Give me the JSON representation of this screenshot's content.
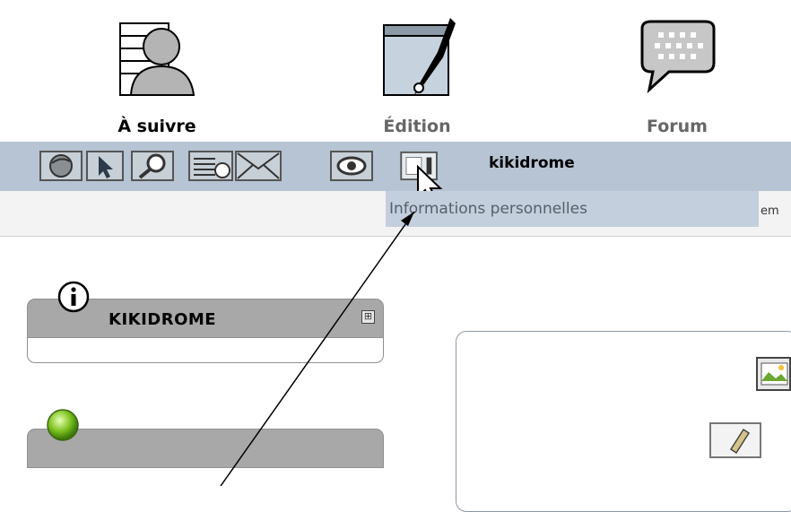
{
  "nav": {
    "items": [
      {
        "label": "À suivre",
        "color": "#000000",
        "icon": "user-list-icon"
      },
      {
        "label": "Édition",
        "color": "#666666",
        "icon": "pen-edit-icon"
      },
      {
        "label": "Forum",
        "color": "#666666",
        "icon": "speech-bubble-icon"
      }
    ]
  },
  "toolbar": {
    "username": "kikidrome",
    "tooltip": "Informations personnelles",
    "subbar_partial_text": "em",
    "tools": [
      "globe-icon",
      "cursor-icon",
      "search-zoom-icon",
      "agenda-icon",
      "mail-icon",
      "eye-icon",
      "personal-info-icon"
    ]
  },
  "panels": [
    {
      "title": "KIKIDROME",
      "icon": "info-icon",
      "expand": "⊞"
    },
    {
      "title": "",
      "icon": "green-orb-icon"
    }
  ],
  "colors": {
    "toolbar_bg": "#b6c4d4",
    "tooltip_bg": "#c3cfdc",
    "panel_header": "#a8a8a8"
  }
}
